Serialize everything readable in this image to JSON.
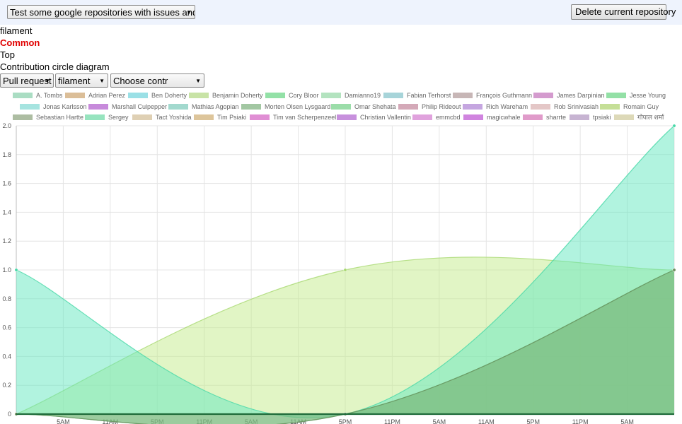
{
  "toolbar": {
    "repo_select": "Test some google repositories with issues and PR",
    "delete_button": "Delete current repository"
  },
  "info": {
    "repo_name": "filament",
    "category": "Common",
    "rank": "Top",
    "diagram_title": "Contribution circle diagram"
  },
  "filters": {
    "type_select": "Pull request",
    "repo_select": "filament",
    "contributor_select": "Choose contr"
  },
  "legend": [
    {
      "label": "A. Tombs",
      "color": "#b9f0d4"
    },
    {
      "label": "Adrian Perez",
      "color": "#eecfa5"
    },
    {
      "label": "Ben Doherty",
      "color": "#a9f4fa"
    },
    {
      "label": "Benjamin Doherty",
      "color": "#d9f7b4"
    },
    {
      "label": "Cory Bloor",
      "color": "#a0f5b6"
    },
    {
      "label": "Damianno19",
      "color": "#c3f7d0"
    },
    {
      "label": "Fabian Terhorst",
      "color": "#b5e6ec"
    },
    {
      "label": "François Guthmann",
      "color": "#d8c6c6"
    },
    {
      "label": "James Darpinian",
      "color": "#e6a8e0"
    },
    {
      "label": "Jesse Young",
      "color": "#a0f4b4"
    },
    {
      "label": "Jonas Karlsson",
      "color": "#b4f8f3"
    },
    {
      "label": "Marshall Culpepper",
      "color": "#d896ee"
    },
    {
      "label": "Mathias Agopian",
      "color": "#b0ece0"
    },
    {
      "label": "Morten Olsen Lysgaard",
      "color": "#b0d8b0"
    },
    {
      "label": "Omar Shehata",
      "color": "#a8f0b8"
    },
    {
      "label": "Philip Rideout",
      "color": "#e6b8c8"
    },
    {
      "label": "Rich Wareham",
      "color": "#d6b4f4"
    },
    {
      "label": "Rob Srinivasiah",
      "color": "#f8d8d8"
    },
    {
      "label": "Romain Guy",
      "color": "#d6f2a4"
    },
    {
      "label": "Sebastian Hartte",
      "color": "#bccdb0"
    },
    {
      "label": "Sergey",
      "color": "#a4f8d0"
    },
    {
      "label": "Tact Yoshida",
      "color": "#f2e2c4"
    },
    {
      "label": "Tim Psiaki",
      "color": "#f0d6a8"
    },
    {
      "label": "Tim van Scherpenzeel",
      "color": "#f49ae6"
    },
    {
      "label": "Christian Vallentin",
      "color": "#d89cf0"
    },
    {
      "label": "emmcbd",
      "color": "#f4b0f0"
    },
    {
      "label": "magicwhale",
      "color": "#e290f2"
    },
    {
      "label": "sharrte",
      "color": "#f4a8dc"
    },
    {
      "label": "tpsiaki",
      "color": "#d8c4e4"
    },
    {
      "label": "गोपाल शर्मा",
      "color": "#f0ecc8"
    }
  ],
  "chart_data": {
    "type": "area",
    "x": [
      "",
      "5AM",
      "11AM",
      "5PM",
      "11PM",
      "5AM",
      "11AM",
      "5PM",
      "11PM",
      "5AM",
      "11AM",
      "5PM",
      "11PM",
      "5AM",
      ""
    ],
    "x_ticks": [
      "5AM",
      "11AM",
      "5PM",
      "11PM",
      "5AM",
      "11AM",
      "5PM",
      "11PM",
      "5AM",
      "11AM",
      "5PM",
      "11PM",
      "5AM"
    ],
    "ylim": [
      0,
      2.0
    ],
    "y_ticks": [
      "0",
      "0.2",
      "0.4",
      "0.6",
      "0.8",
      "1.0",
      "1.2",
      "1.4",
      "1.6",
      "1.8",
      "2.0"
    ],
    "grid": true,
    "legend_position": "top",
    "series": [
      {
        "name": "Romain Guy",
        "fill": "#c4ec8c",
        "stroke": "#a8d870",
        "points": [
          [
            0,
            0
          ],
          [
            0.5,
            1.0
          ],
          [
            1,
            1.0
          ]
        ]
      },
      {
        "name": "Sergey",
        "fill": "#64e8c0",
        "stroke": "#48d8a8",
        "points": [
          [
            0,
            1.0
          ],
          [
            0.5,
            0
          ],
          [
            1,
            2.0
          ]
        ]
      },
      {
        "name": "Jesse Young",
        "fill": "#5ce48c",
        "stroke": "#40d070",
        "points": [
          [
            0,
            0
          ],
          [
            0.5,
            0
          ],
          [
            1,
            1.0
          ]
        ]
      },
      {
        "name": "Sebastian Hartte",
        "fill": "#8aa878",
        "stroke": "#708e60",
        "points": [
          [
            0,
            0
          ],
          [
            0.5,
            0
          ],
          [
            1,
            1.0
          ]
        ]
      }
    ]
  }
}
